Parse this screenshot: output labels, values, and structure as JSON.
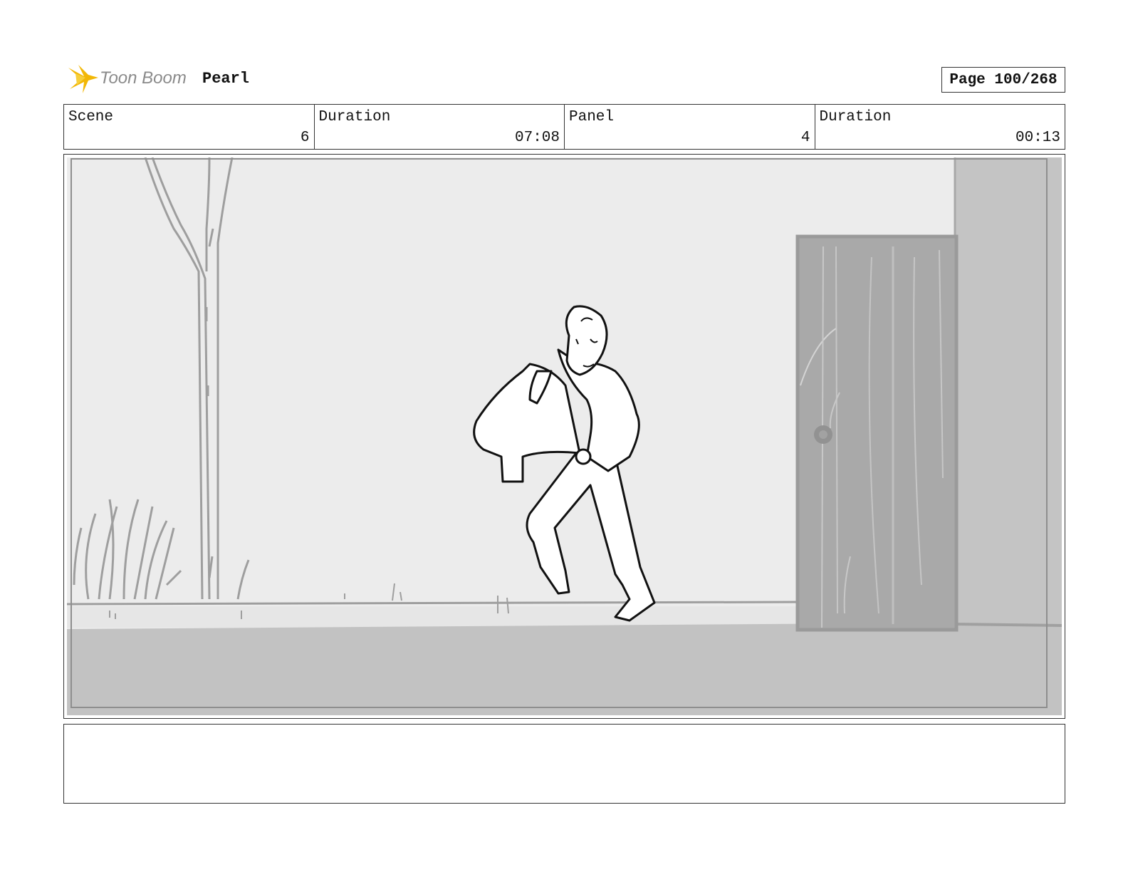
{
  "header": {
    "logo_text": "Toon Boom",
    "project_title": "Pearl",
    "page_label": "Page 100/268"
  },
  "info": {
    "scene_label": "Scene",
    "scene_value": "6",
    "scene_duration_label": "Duration",
    "scene_duration_value": "07:08",
    "panel_label": "Panel",
    "panel_value": "4",
    "panel_duration_label": "Duration",
    "panel_duration_value": "00:13"
  },
  "notes": {
    "text": ""
  },
  "colors": {
    "logo_accent": "#f2b705",
    "logo_text": "#8a8a8a",
    "panel_sky": "#ececec",
    "panel_ground": "#c2c2c2",
    "panel_door": "#a9a9a9",
    "border": "#333333"
  }
}
